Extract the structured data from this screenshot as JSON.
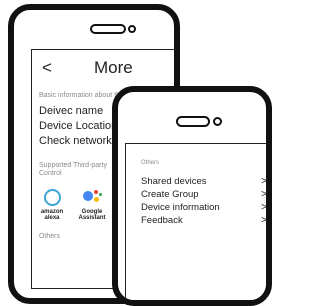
{
  "back_screen": {
    "back_glyph": "<",
    "title": "More",
    "basic_info_caption": "Basic information about the device",
    "items": [
      "Deivec name",
      "Device Location",
      "Check network"
    ],
    "third_party_caption_line1": "Supported Third-party",
    "third_party_caption_line2": "Control",
    "assistants": [
      {
        "name_line1": "amazon",
        "name_line2": "alexa",
        "icon": "alexa-icon"
      },
      {
        "name_line1": "Google",
        "name_line2": "Assistant",
        "icon": "google-assistant-icon"
      }
    ],
    "others_caption": "Others"
  },
  "front_screen": {
    "others_caption": "Others",
    "items": [
      {
        "label": "Shared devices",
        "chevron": ">"
      },
      {
        "label": "Create Group",
        "chevron": ">"
      },
      {
        "label": "Device information",
        "chevron": ">"
      },
      {
        "label": "Feedback",
        "chevron": ">"
      }
    ]
  },
  "colors": {
    "frame": "#111111",
    "caption_gray": "#8a8a8a",
    "alexa_blue": "#3aa7d6",
    "google_blue": "#4285f4",
    "google_red": "#ea4335",
    "google_yellow": "#fbbc05",
    "google_green": "#34a853"
  }
}
